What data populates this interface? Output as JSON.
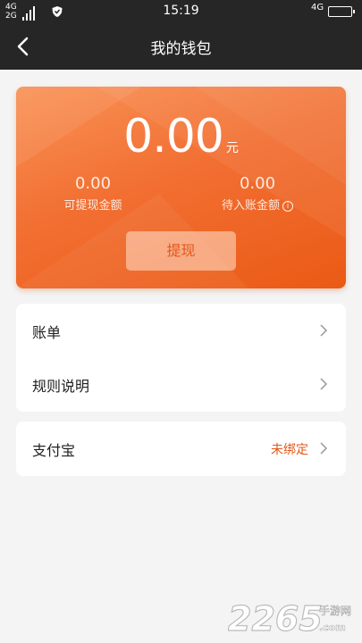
{
  "status_bar": {
    "network_top": "4G",
    "network_bottom": "2G",
    "time": "15:19",
    "network_right": "4G",
    "icons": [
      "signal-icon",
      "shield-icon",
      "battery-icon"
    ]
  },
  "nav": {
    "title": "我的钱包",
    "back_icon": "back-arrow-icon"
  },
  "balance": {
    "total": "0.00",
    "unit": "元",
    "withdrawable_amount": "0.00",
    "withdrawable_label": "可提现金额",
    "pending_amount": "0.00",
    "pending_label": "待入账金额",
    "info_icon": "i",
    "withdraw_label": "提现"
  },
  "menu": {
    "items": [
      {
        "label": "账单"
      },
      {
        "label": "规则说明"
      }
    ],
    "alipay": {
      "label": "支付宝",
      "value": "未绑定"
    }
  },
  "watermark": {
    "brand": "2265",
    "site": "手游网",
    "domain": ".com"
  },
  "colors": {
    "header_bg": "#262626",
    "accent": "#ef6a2a",
    "accent_text": "#e4571a",
    "page_bg": "#f4f4f4"
  }
}
